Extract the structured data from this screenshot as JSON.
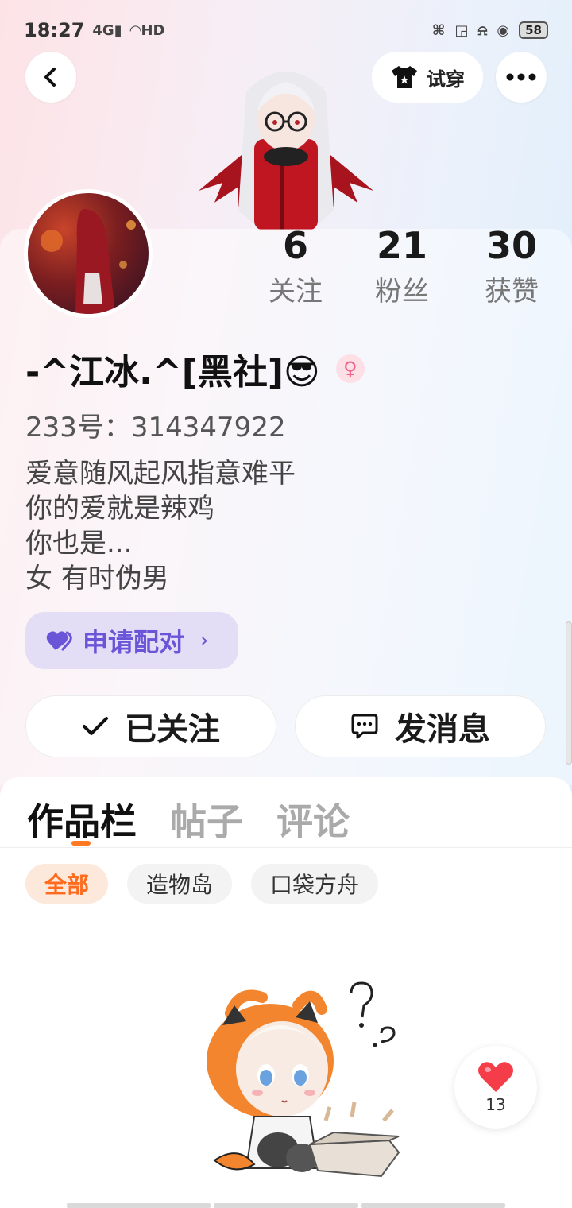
{
  "status_bar": {
    "time": "18:27",
    "network": "4G",
    "wifi": "HD",
    "battery": "58"
  },
  "header": {
    "try_on_label": "试穿"
  },
  "profile": {
    "stats": [
      {
        "value": "6",
        "label": "关注"
      },
      {
        "value": "21",
        "label": "粉丝"
      },
      {
        "value": "30",
        "label": "获赞"
      }
    ],
    "name": "-^江冰.^[黑社]😎",
    "gender_symbol": "♀",
    "uid": "233号：314347922",
    "bio": [
      "爱意随风起风指意难平",
      "你的爱就是辣鸡",
      "你也是...",
      "女 有时伪男"
    ],
    "pair_label": "申请配对"
  },
  "actions": {
    "follow_label": "已关注",
    "message_label": "发消息"
  },
  "tabs": [
    "作品栏",
    "帖子",
    "评论"
  ],
  "filters": [
    "全部",
    "造物岛",
    "口袋方舟"
  ],
  "like_count": "13",
  "colors": {
    "accent": "#ff7a22",
    "pair": "#6a55d8",
    "like": "#f53d4a"
  }
}
